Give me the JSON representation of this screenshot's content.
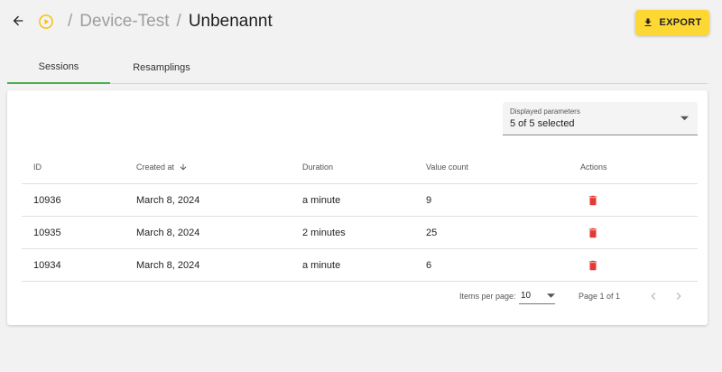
{
  "header": {
    "breadcrumb_parent": "Device-Test",
    "breadcrumb_current": "Unbenannt",
    "separator": "/",
    "export_label": "EXPORT",
    "accent_color": "#fdd835"
  },
  "tabs": [
    {
      "label": "Sessions",
      "active": true
    },
    {
      "label": "Resamplings",
      "active": false
    }
  ],
  "filter": {
    "label": "Displayed parameters",
    "value": "5 of 5 selected"
  },
  "table": {
    "columns": [
      "ID",
      "Created at",
      "Duration",
      "Value count",
      "Actions"
    ],
    "sort_column": "Created at",
    "sort_direction": "descending",
    "rows": [
      {
        "id": "10936",
        "created_at": "March 8, 2024",
        "duration": "a minute",
        "value_count": "9"
      },
      {
        "id": "10935",
        "created_at": "March 8, 2024",
        "duration": "2 minutes",
        "value_count": "25"
      },
      {
        "id": "10934",
        "created_at": "March 8, 2024",
        "duration": "a minute",
        "value_count": "6"
      }
    ],
    "delete_icon_color": "#e53935"
  },
  "paginator": {
    "items_per_page_label": "Items per page:",
    "items_per_page": "10",
    "range_label": "Page 1 of 1"
  },
  "icons": {
    "back": "arrow-left-icon",
    "status": "play-circle-icon",
    "export": "download-icon",
    "sort": "arrow-down-icon",
    "delete": "trash-icon",
    "prev": "chevron-left-icon",
    "next": "chevron-right-icon",
    "dropdown": "caret-down-icon"
  }
}
